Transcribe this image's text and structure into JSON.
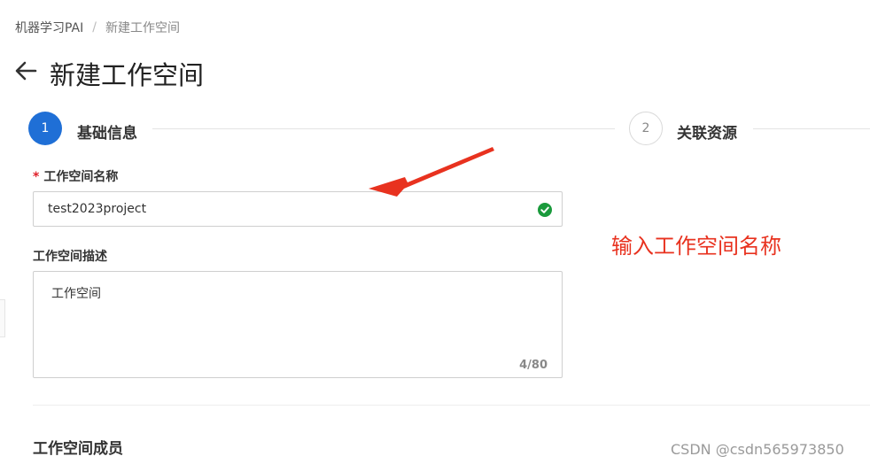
{
  "breadcrumb": {
    "root": "机器学习PAI",
    "separator": "/",
    "current": "新建工作空间"
  },
  "page": {
    "title": "新建工作空间",
    "back_icon": "arrow-left-icon"
  },
  "steps": [
    {
      "number": "1",
      "label": "基础信息",
      "state": "active"
    },
    {
      "number": "2",
      "label": "关联资源",
      "state": "pending"
    }
  ],
  "form": {
    "name": {
      "required_mark": "*",
      "label": "工作空间名称",
      "value": "test2023project",
      "status_icon": "check-circle-icon"
    },
    "description": {
      "label": "工作空间描述",
      "value": "工作空间",
      "count": "4/80"
    },
    "members_title": "工作空间成员"
  },
  "annotation": {
    "text": "输入工作空间名称",
    "color": "#e8321f"
  },
  "watermark": "CSDN @csdn565973850",
  "colors": {
    "primary": "#1f6fd6",
    "success": "#1a9a3c",
    "required": "#e0202a"
  }
}
